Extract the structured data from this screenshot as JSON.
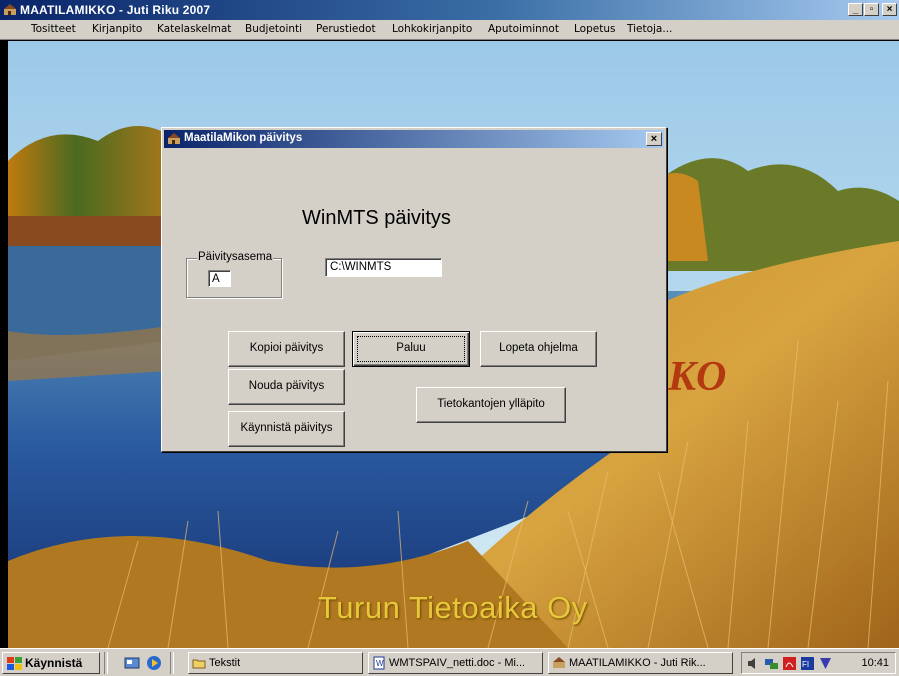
{
  "window": {
    "title": "MAATILAMIKKO - Juti Riku  2007",
    "controls": {
      "minimize": "_",
      "restore": "▫",
      "close": "×"
    }
  },
  "menubar": {
    "items": [
      "Tositteet",
      "Kirjanpito",
      "Katelaskelmat",
      "Budjetointi",
      "Perustiedot",
      "Lohkokirjanpito",
      "Aputoiminnot",
      "Lopetus",
      "Tietoja..."
    ]
  },
  "desktop": {
    "watermark": "Turun Tietoaika Oy",
    "partial_logo_text": "KO"
  },
  "dialog": {
    "title": "MaatilaMikon päivitys",
    "close_label": "×",
    "heading": "WinMTS  päivitys",
    "drive_group_label": "Päivitysasema",
    "drive_value": "A",
    "path_value": "C:\\WINMTS",
    "buttons": {
      "copy": "Kopioi päivitys",
      "back": "Paluu",
      "quit": "Lopeta ohjelma",
      "fetch": "Nouda päivitys",
      "db_maint": "Tietokantojen ylläpito",
      "start": "Käynnistä päivitys"
    }
  },
  "taskbar": {
    "start_label": "Käynnistä",
    "tasks": [
      {
        "label": "Tekstit"
      },
      {
        "label": "WMTSPAIV_netti.doc - Mi..."
      },
      {
        "label": "MAATILAMIKKO - Juti Rik..."
      }
    ],
    "clock": "10:41"
  },
  "colors": {
    "titlebar_start": "#0a246a",
    "titlebar_end": "#a6caf0",
    "face": "#d4d0c8",
    "watermark": "#e8c83a"
  }
}
